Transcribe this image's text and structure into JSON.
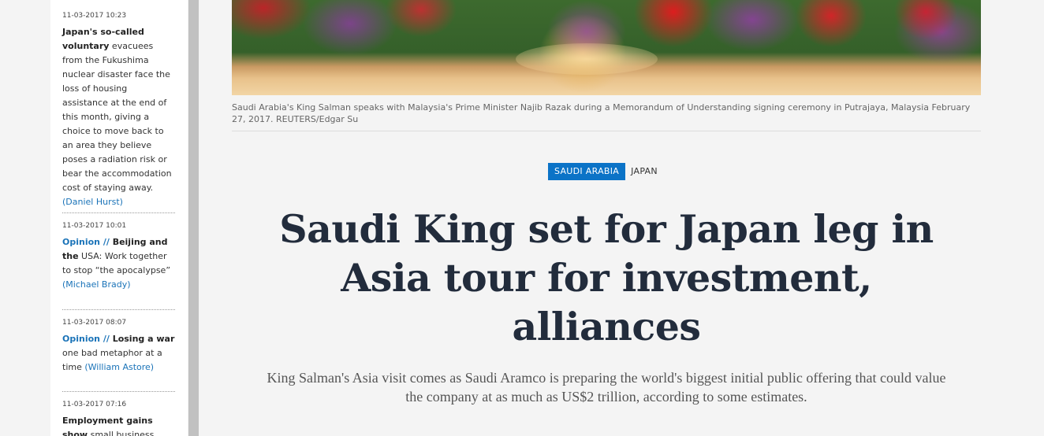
{
  "sidebar": {
    "items": [
      {
        "time": "11-03-2017 10:23",
        "bold": "Japan's so-called voluntary",
        "text": " evacuees from the Fukushima nuclear disaster face the loss of housing assistance at the end of this month, giving a choice to move back to an area they believe poses a radiation risk or bear the accommodation cost of staying away.",
        "author": "(Daniel Hurst)"
      },
      {
        "time": "11-03-2017 10:01",
        "tag": "Opinion //",
        "bold": " Beijing and the",
        "text": " USA: Work together to stop “the apocalypse”",
        "author": "(Michael Brady)"
      },
      {
        "time": "11-03-2017 08:07",
        "tag": "Opinion //",
        "bold": " Losing a war",
        "text": " one bad metaphor at a time",
        "author": "(William Astore)"
      },
      {
        "time": "11-03-2017 07:16",
        "bold": "Employment gains show",
        "text": " small business"
      }
    ]
  },
  "article": {
    "caption": "Saudi Arabia's King Salman speaks with Malaysia's Prime Minister Najib Razak during a Memorandum of Understanding signing ceremony in Putrajaya, Malaysia February 27, 2017. REUTERS/Edgar Su",
    "tags": [
      "SAUDI ARABIA",
      "JAPAN"
    ],
    "headline": "Saudi King set for Japan leg in Asia tour for investment, alliances",
    "standfirst": "King Salman's Asia visit comes as Saudi Aramco is preparing the world's biggest initial public offering that could value the company at as much as US$2 trillion, according to some estimates."
  },
  "colors": {
    "tag_primary": "#0b73c7",
    "link": "#1a73b8",
    "headline": "#222c3c"
  }
}
